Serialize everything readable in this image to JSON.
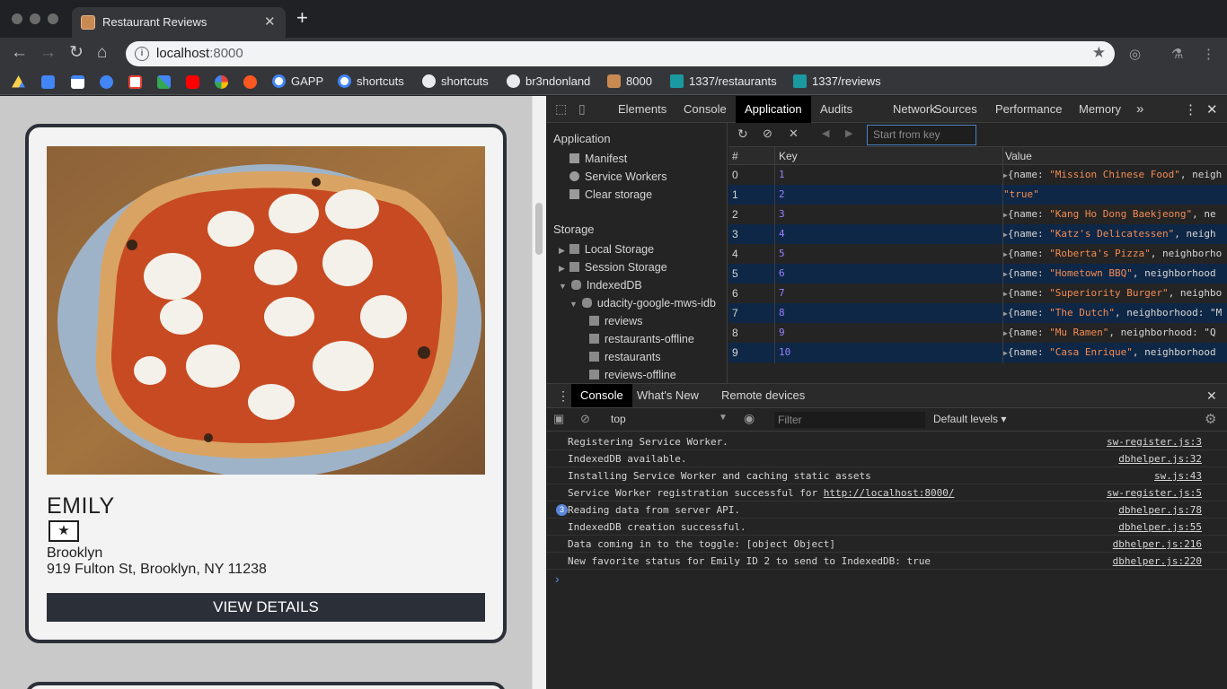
{
  "browser": {
    "tab_title": "Restaurant Reviews",
    "new_tab_glyph": "+",
    "url_host": "localhost",
    "url_port": ":8000",
    "bookmarks": [
      {
        "label": "GAPP",
        "icon": "google-icon"
      },
      {
        "label": "shortcuts",
        "icon": "google-icon"
      },
      {
        "label": "shortcuts",
        "icon": "github-icon"
      },
      {
        "label": "br3ndonland",
        "icon": "github-icon"
      },
      {
        "label": "8000",
        "icon": "restaurant-favicon"
      },
      {
        "label": "1337/restaurants",
        "icon": "server-icon"
      },
      {
        "label": "1337/reviews",
        "icon": "server-icon"
      }
    ]
  },
  "page": {
    "restaurant_name": "EMILY",
    "favorite_glyph": "★",
    "neighborhood": "Brooklyn",
    "address": "919 Fulton St, Brooklyn, NY 11238",
    "details_label": "VIEW DETAILS"
  },
  "devtools": {
    "tabs": [
      "Elements",
      "Console",
      "Application",
      "Audits",
      "Network",
      "Sources",
      "Performance",
      "Memory"
    ],
    "active_tab": "Application",
    "more_glyph": "»",
    "sidebar": {
      "application_header": "Application",
      "manifest": "Manifest",
      "service_workers": "Service Workers",
      "clear_storage": "Clear storage",
      "storage_header": "Storage",
      "local_storage": "Local Storage",
      "session_storage": "Session Storage",
      "indexeddb": "IndexedDB",
      "db_name": "udacity-google-mws-idb",
      "stores": [
        "reviews",
        "restaurants-offline",
        "restaurants",
        "reviews-offline"
      ]
    },
    "start_from_key_placeholder": "Start from key",
    "grid_headers": {
      "num": "#",
      "key": "Key",
      "value": "Value"
    },
    "rows": [
      {
        "num": "0",
        "key": "1",
        "prefix": "{name: ",
        "str": "\"Mission Chinese Food\"",
        "suffix": ", neigh"
      },
      {
        "num": "1",
        "key": "2",
        "prefix": "",
        "str": "\"true\"",
        "suffix": "",
        "plain": true
      },
      {
        "num": "2",
        "key": "3",
        "prefix": "{name: ",
        "str": "\"Kang Ho Dong Baekjeong\"",
        "suffix": ", ne"
      },
      {
        "num": "3",
        "key": "4",
        "prefix": "{name: ",
        "str": "\"Katz's Delicatessen\"",
        "suffix": ", neigh"
      },
      {
        "num": "4",
        "key": "5",
        "prefix": "{name: ",
        "str": "\"Roberta's Pizza\"",
        "suffix": ", neighborho"
      },
      {
        "num": "5",
        "key": "6",
        "prefix": "{name: ",
        "str": "\"Hometown BBQ\"",
        "suffix": ", neighborhood"
      },
      {
        "num": "6",
        "key": "7",
        "prefix": "{name: ",
        "str": "\"Superiority Burger\"",
        "suffix": ", neighbo"
      },
      {
        "num": "7",
        "key": "8",
        "prefix": "{name: ",
        "str": "\"The Dutch\"",
        "suffix": ", neighborhood: \"M"
      },
      {
        "num": "8",
        "key": "9",
        "prefix": "{name: ",
        "str": "\"Mu Ramen\"",
        "suffix": ", neighborhood: \"Q"
      },
      {
        "num": "9",
        "key": "10",
        "prefix": "{name: ",
        "str": "\"Casa Enrique\"",
        "suffix": ", neighborhood"
      }
    ],
    "drawer_tabs": [
      "Console",
      "What's New",
      "Remote devices"
    ],
    "context": "top",
    "filter_placeholder": "Filter",
    "levels": "Default levels ▾",
    "messages": [
      {
        "text": "Registering Service Worker.",
        "src": "sw-register.js:3"
      },
      {
        "text": "IndexedDB available.",
        "src": "dbhelper.js:32"
      },
      {
        "text": "Installing Service Worker and caching static assets",
        "src": "sw.js:43"
      },
      {
        "text": "Service Worker registration successful for ",
        "link": "http://localhost:8000/",
        "src": "sw-register.js:5"
      },
      {
        "text": "Reading data from server API.",
        "src": "dbhelper.js:78",
        "count": "3"
      },
      {
        "text": "IndexedDB creation successful.",
        "src": "dbhelper.js:55"
      },
      {
        "text": "Data coming in to the toggle: [object Object]",
        "src": "dbhelper.js:216"
      },
      {
        "text": "New favorite status for Emily ID 2 to send to IndexedDB: true",
        "src": "dbhelper.js:220"
      }
    ],
    "prompt_glyph": "›"
  }
}
